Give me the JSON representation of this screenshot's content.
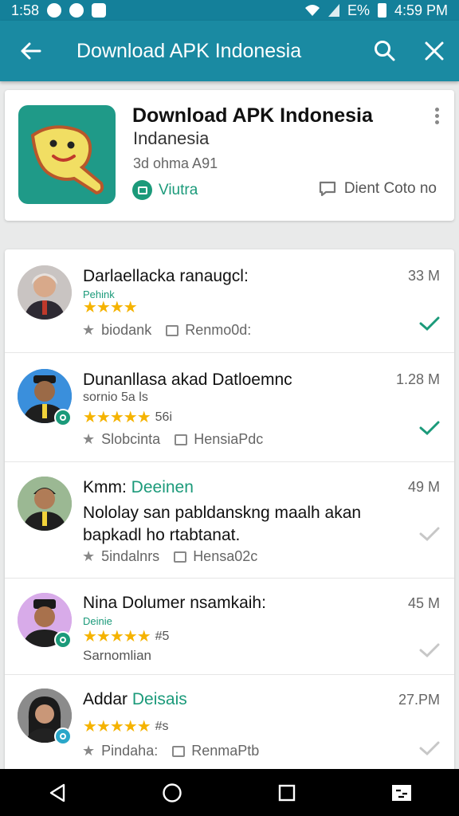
{
  "status_bar": {
    "time": "1:58",
    "battery_text": "E%",
    "right_time": "4:59 PM"
  },
  "app_bar": {
    "title": "Download APK Indonesia",
    "icons": [
      "arrow-back-icon",
      "search-icon",
      "close-icon"
    ]
  },
  "app_card": {
    "title": "Download APK Indonesia",
    "subtitle": "Indanesia",
    "meta": "3d ohma A91",
    "install_label": "Viutra",
    "detail_label": "Dient Coto no"
  },
  "reviews": [
    {
      "name": "Darlaellacka ranaugcl:",
      "size": "33 M",
      "tag": "Pehink",
      "stars": "★★★★",
      "stars_extra": "",
      "meta_left": "biodank",
      "meta_right": "Renmo0d:",
      "checked": true
    },
    {
      "name": "Dunanllasa akad Datloemnc",
      "size": "1.28 M",
      "tag": "sornio 5a ls",
      "stars": "★★★★★",
      "stars_extra": "56i",
      "meta_left": "Slobcinta",
      "meta_right": "HensiaPdc",
      "checked": true
    },
    {
      "name": "Kmm:",
      "name_accent": "Deeinen",
      "size": "49 M",
      "body": "Nololay san pabldanskng maalh akan bapkadl ho rtabtanat.",
      "meta_left": "5indalnrs",
      "meta_right": "Hensa02c",
      "checked": false
    },
    {
      "name": "Nina Dolumer nsamkaih:",
      "size": "45 M",
      "tag": "Deinie",
      "stars": "★★★★★",
      "stars_extra": "#5",
      "sub": "Sarnomlian",
      "checked": false
    },
    {
      "name": "Addar",
      "name_accent": "Deisais",
      "size": "27.PM",
      "stars": "★★★★★",
      "stars_extra": "#s",
      "meta_left": "Pindaha:",
      "meta_right": "RenmaPtb",
      "checked": false
    }
  ],
  "colors": {
    "primary": "#1a8aa2",
    "accent": "#1b9a7a",
    "star": "#f5b300"
  },
  "nav_bar": {
    "icons": [
      "back-triangle-icon",
      "home-circle-icon",
      "recents-square-icon",
      "screenshot-icon"
    ]
  }
}
